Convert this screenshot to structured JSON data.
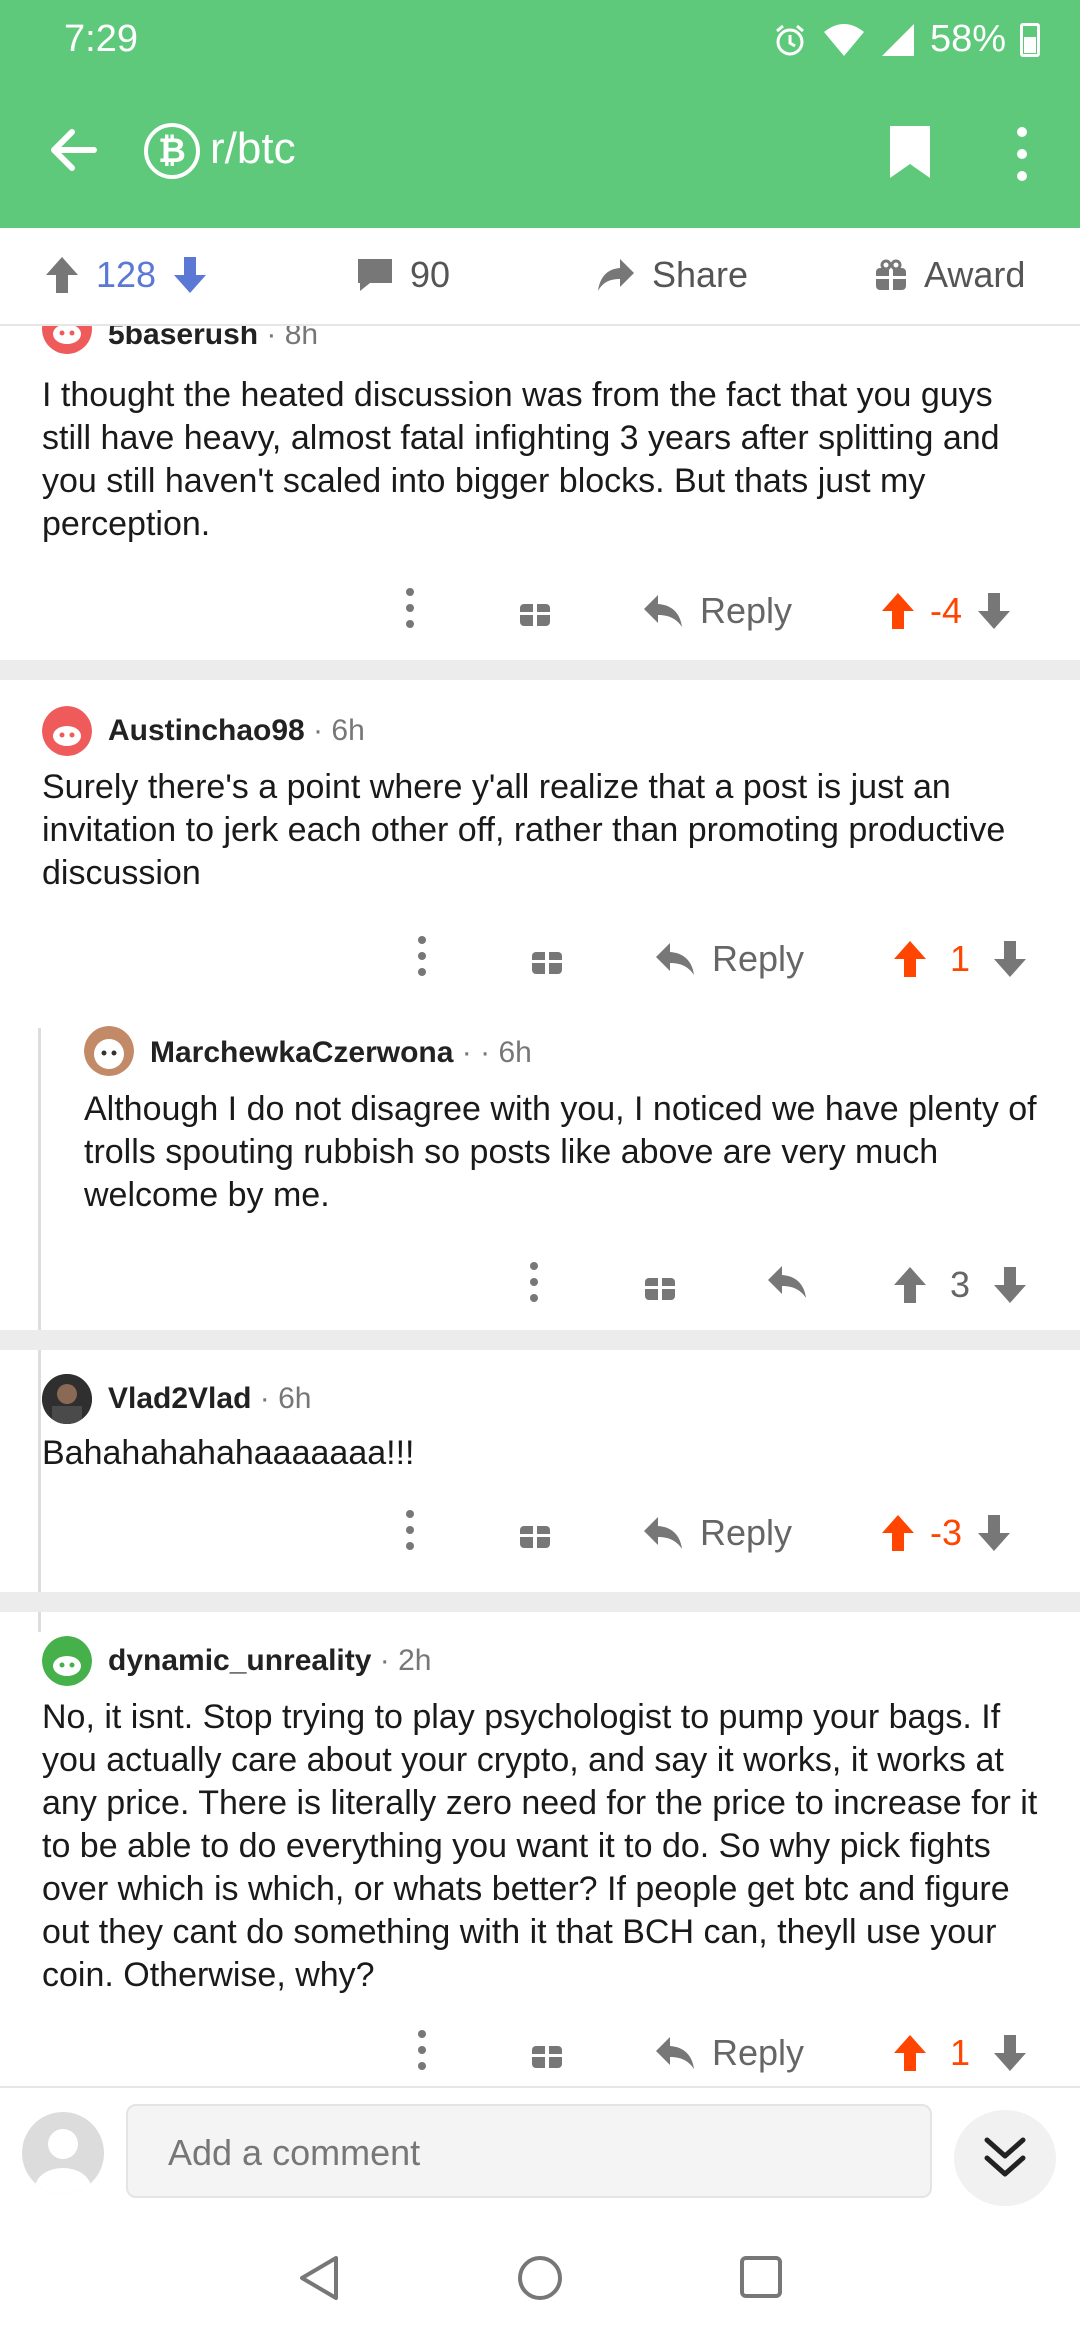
{
  "status": {
    "time": "7:29",
    "battery": "58%"
  },
  "header": {
    "subreddit": "r/btc",
    "sub_icon": "₿"
  },
  "postbar": {
    "upvotes": "128",
    "comments": "90",
    "share": "Share",
    "award": "Award"
  },
  "colors": {
    "brand_green": "#5ec97a",
    "upvote_orange": "#ff4500",
    "upvote_blue": "#5b79d4"
  },
  "comments": [
    {
      "user": "5baserush",
      "time": "8h",
      "body": "I thought the heated discussion was from the fact that you guys still have heavy, almost fatal infighting 3 years after splitting and you still haven't scaled into bigger blocks. But thats just my perception.",
      "reply": "Reply",
      "score": "-4"
    },
    {
      "user": "Austinchao98",
      "time": "6h",
      "body": "Surely there's a point where y'all realize that a post is just an invitation to jerk each other off, rather than promoting productive discussion",
      "reply": "Reply",
      "score": "1"
    },
    {
      "user": "MarchewkaCzerwona",
      "time": "6h",
      "body": "Although I do not disagree with you, I noticed we have plenty of trolls spouting rubbish so posts like above are very much welcome by me.",
      "score": "3"
    },
    {
      "user": "Vlad2Vlad",
      "time": "6h",
      "body": "Bahahahahahaaaaaaa!!!",
      "reply": "Reply",
      "score": "-3"
    },
    {
      "user": "dynamic_unreality",
      "time": "2h",
      "body": "No, it isnt. Stop trying to play psychologist to pump your bags. If you actually care about your crypto, and say it works, it works at any price. There is literally zero need for the price to increase for it to be able to do everything you want it to do. So why pick fights over which is which, or whats better? If people get btc and figure out they cant do something with it that BCH can, theyll use your coin. Otherwise, why?",
      "reply": "Reply",
      "score": "1"
    }
  ],
  "composer": {
    "placeholder": "Add a comment"
  }
}
